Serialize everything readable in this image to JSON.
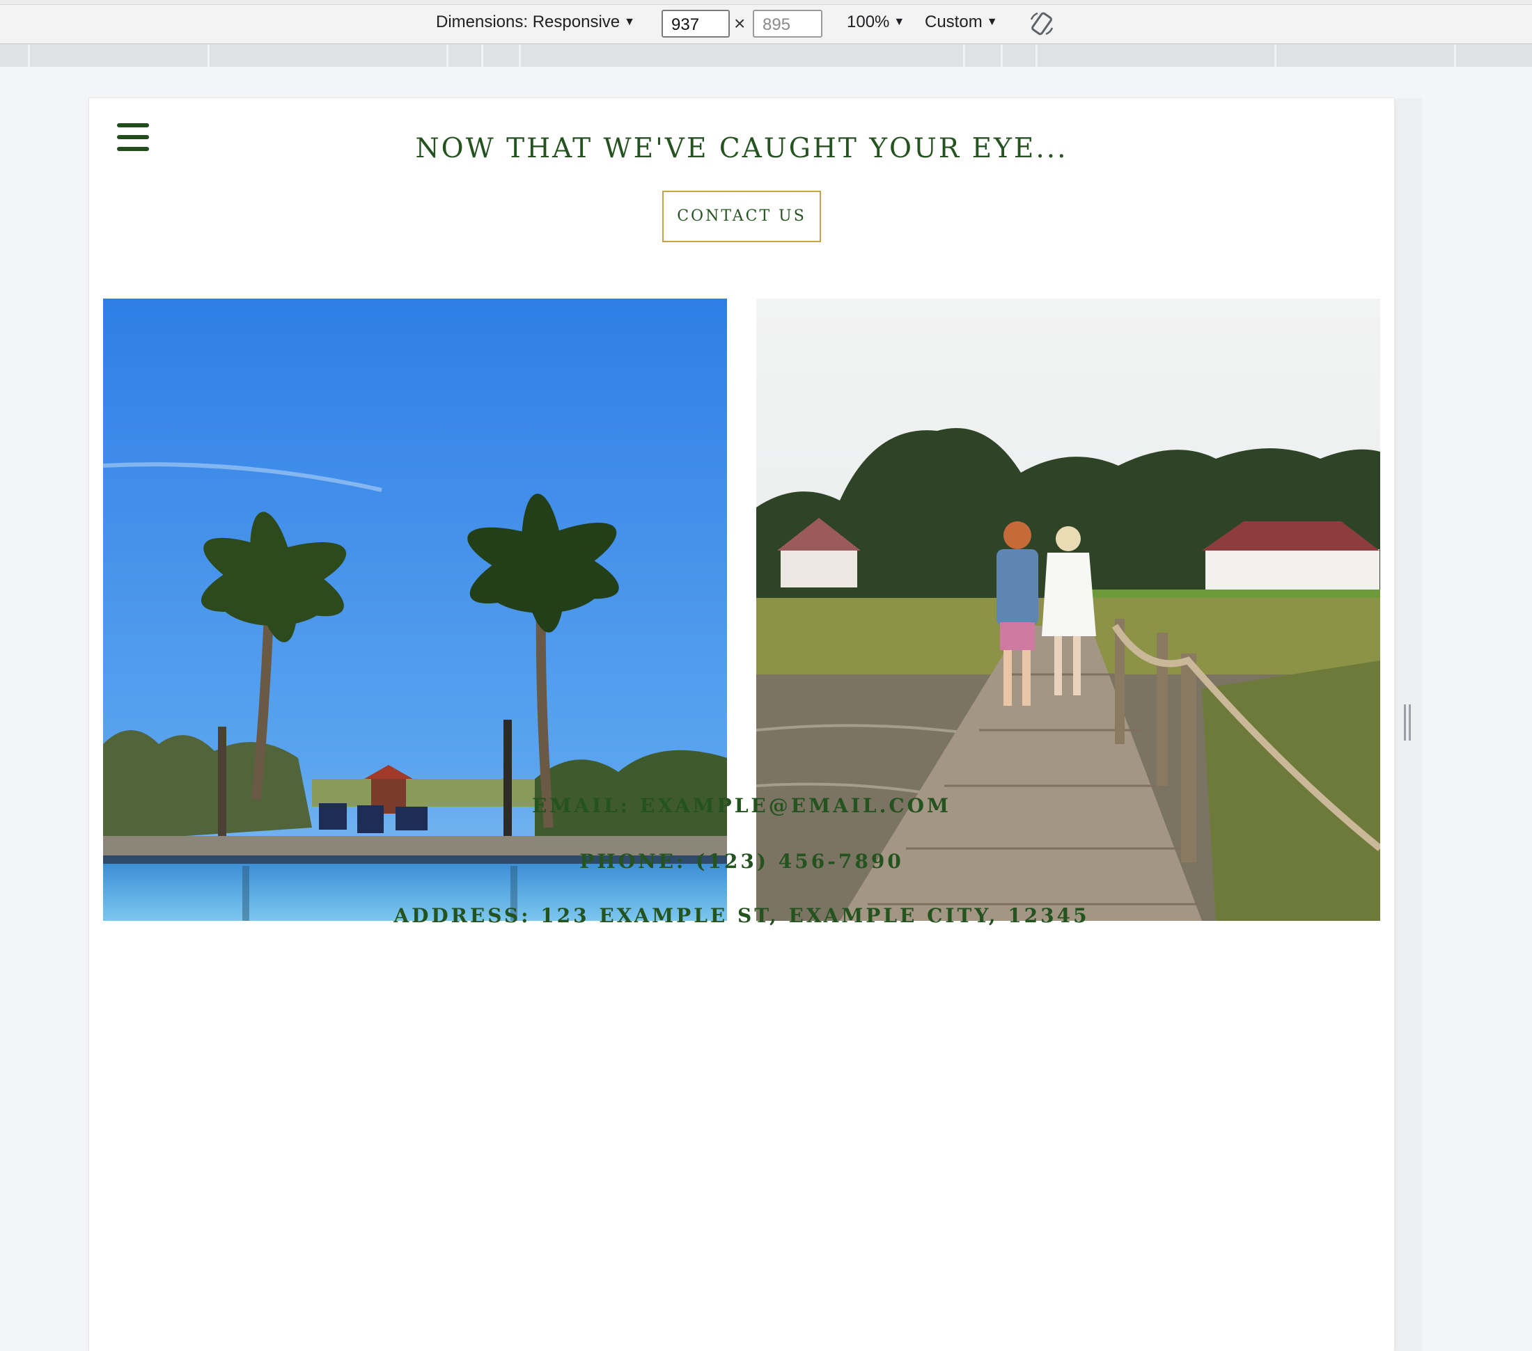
{
  "devtools": {
    "dimensions_label": "Dimensions: Responsive",
    "width_value": "937",
    "height_placeholder": "895",
    "times_symbol": "×",
    "zoom_label": "100%",
    "throttle_label": "Custom",
    "caret": "▼"
  },
  "page": {
    "headline": "NOW THAT WE'VE CAUGHT YOUR EYE...",
    "contact_button": "CONTACT US",
    "contact": {
      "email": "EMAIL: EXAMPLE@EMAIL.COM",
      "phone": "PHONE: (123) 456-7890",
      "address": "ADDRESS: 123 EXAMPLE ST, EXAMPLE CITY, 12345"
    }
  },
  "colors": {
    "brand_green": "#245320",
    "button_border_gold": "#c8a24a"
  },
  "icons": {
    "menu": "hamburger-menu-icon",
    "rotate": "rotate-device-icon"
  }
}
